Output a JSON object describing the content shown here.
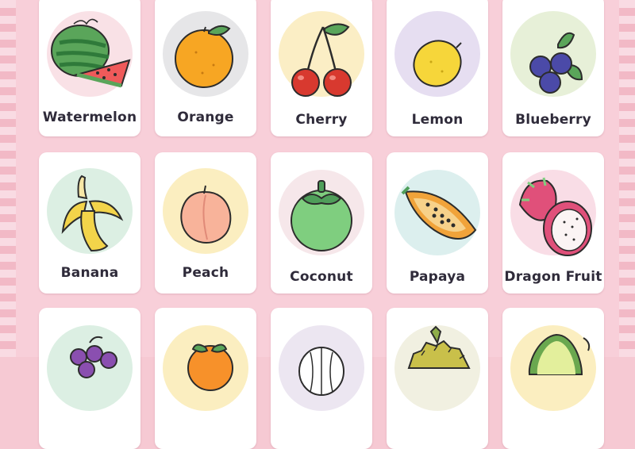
{
  "fruits": [
    {
      "label": "Watermelon",
      "bg": "#f9e1e6",
      "icon": "watermelon-icon"
    },
    {
      "label": "Orange",
      "bg": "#e6e6e8",
      "icon": "orange-icon"
    },
    {
      "label": "Cherry",
      "bg": "#fbeec5",
      "icon": "cherry-icon"
    },
    {
      "label": "Lemon",
      "bg": "#e6def1",
      "icon": "lemon-icon"
    },
    {
      "label": "Blueberry",
      "bg": "#e7f0d8",
      "icon": "blueberry-icon"
    },
    {
      "label": "Banana",
      "bg": "#dcefe3",
      "icon": "banana-icon"
    },
    {
      "label": "Peach",
      "bg": "#fbeec0",
      "icon": "peach-icon"
    },
    {
      "label": "Coconut",
      "bg": "#f6e7ea",
      "icon": "coconut-icon"
    },
    {
      "label": "Papaya",
      "bg": "#dcefee",
      "icon": "papaya-icon"
    },
    {
      "label": "Dragon Fruit",
      "bg": "#f9dde6",
      "icon": "dragon-fruit-icon"
    },
    {
      "label": "",
      "bg": "#dcefe3",
      "icon": "grapes-icon"
    },
    {
      "label": "",
      "bg": "#fbeec0",
      "icon": "tangerine-icon"
    },
    {
      "label": "",
      "bg": "#ece6f1",
      "icon": "mangosteen-icon"
    },
    {
      "label": "",
      "bg": "#f1f0e1",
      "icon": "durian-icon"
    },
    {
      "label": "",
      "bg": "#fbeec0",
      "icon": "avocado-icon"
    }
  ]
}
